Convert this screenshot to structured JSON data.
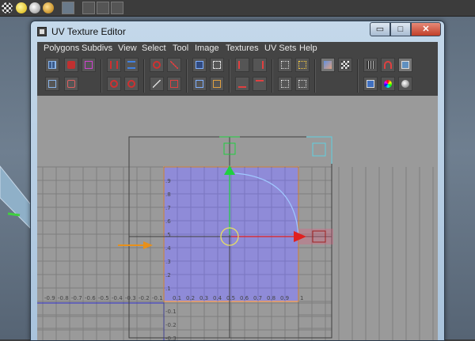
{
  "window": {
    "title": "UV Texture Editor",
    "min_label": "▭",
    "max_label": "□",
    "close_label": "✕"
  },
  "menu": {
    "items": [
      "Polygons",
      "Subdivs",
      "View",
      "Select",
      "Tool",
      "Image",
      "Textures",
      "UV Sets",
      "Help"
    ]
  },
  "axes": {
    "v_ticks": [
      ".9",
      ".8",
      ".7",
      ".6",
      ".5",
      ".4",
      ".3",
      ".2",
      ".1"
    ],
    "u_ticks": [
      "0.1",
      "0.2",
      "0.3",
      "0.4",
      "0.5",
      "0.6",
      "0.7",
      "0.8",
      "0.9"
    ],
    "neg_u_ticks": [
      "-0.9",
      "-0.8",
      "-0.7",
      "-0.6",
      "-0.5",
      "-0.4",
      "-0.3",
      "-0.2",
      "-0.1"
    ],
    "neg_v_ticks": [
      "-0.1",
      "-0.2",
      "-0.3"
    ],
    "origin_label": "1"
  },
  "colors": {
    "uv_tile_fill": "#8f8bd8",
    "uv_tile_border": "#f0a060",
    "grid_bg": "#9a9a9a",
    "manip_x": "#e02020",
    "manip_y": "#20d040",
    "rotate_ring": "#e8e060",
    "arc": "#a0c8ff",
    "orange_arrow": "#e8901a",
    "cyan_box": "#60d0e0"
  },
  "icons": [
    "grid-icon",
    "lattice-icon",
    "move-uv-icon",
    "uv-shell-icon",
    "flip-u-icon",
    "flip-v-icon",
    "rotate-icon",
    "cut-uv-icon",
    "sew-uv-icon",
    "unfold-icon",
    "layout-icon",
    "align-icon",
    "snap-icon",
    "image-display-icon",
    "checker-icon",
    "color-icon",
    "shade-icon",
    "texture-icon"
  ]
}
